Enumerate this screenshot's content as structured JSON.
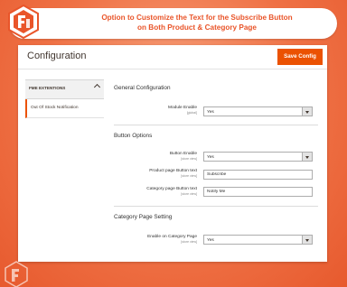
{
  "banner": {
    "line1": "Option to Customize the Text for the Subscribe Button",
    "line2": "on Both Product & Category Page"
  },
  "brand": {
    "accent": "#eb5202",
    "banner_text_color": "#e9552a"
  },
  "panel": {
    "title": "Configuration",
    "save_label": "Save Config"
  },
  "sidebar": {
    "section_label": "FME EXTENTIONS",
    "items": [
      {
        "label": "Out Of Stock Notification"
      }
    ]
  },
  "general": {
    "title": "General Configuration",
    "module_enable_label": "Module Enable",
    "module_enable_scope": "[global]",
    "module_enable_value": "Yes"
  },
  "button_options": {
    "title": "Button Options",
    "button_enable_label": "Button Enable",
    "button_enable_scope": "[store view]",
    "button_enable_value": "Yes",
    "product_text_label": "Product page Button text",
    "product_text_scope": "[store view]",
    "product_text_value": "Subscribe",
    "category_text_label": "Category page Button text",
    "category_text_scope": "[store view]",
    "category_text_value": "Notify Me"
  },
  "category_setting": {
    "title": "Category Page Setting",
    "enable_label": "Enable on Category Page",
    "enable_scope": "[store view]",
    "enable_value": "Yes"
  }
}
